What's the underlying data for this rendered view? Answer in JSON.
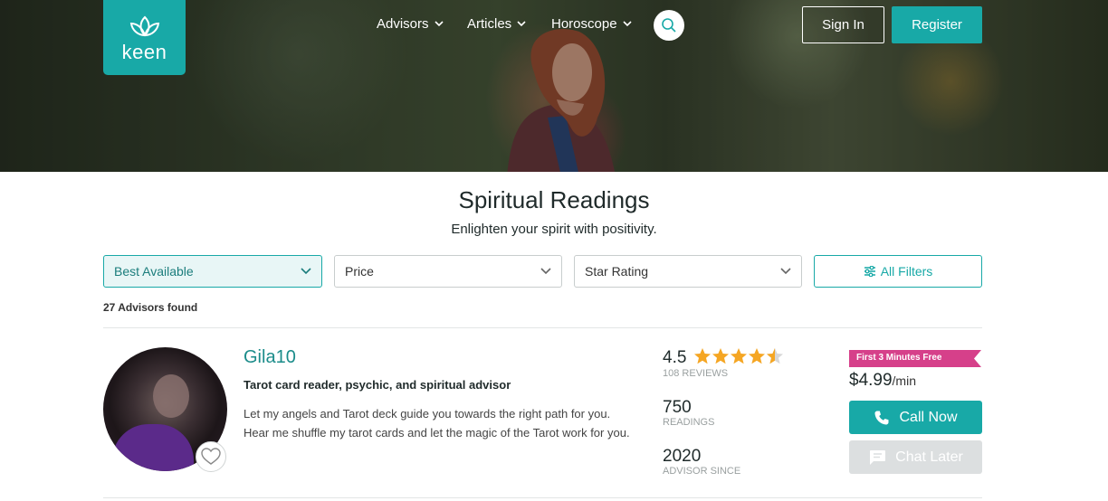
{
  "brand": {
    "logo_text": "keen",
    "accent": "#18a9a7",
    "promo_color": "#d6408a"
  },
  "nav": {
    "items": [
      {
        "label": "Advisors",
        "icon": "chevron-down-icon"
      },
      {
        "label": "Articles",
        "icon": "chevron-down-icon"
      },
      {
        "label": "Horoscope",
        "icon": "chevron-down-icon"
      }
    ],
    "search_icon": "search-icon",
    "sign_in": "Sign In",
    "register": "Register"
  },
  "page": {
    "title": "Spiritual Readings",
    "subtitle": "Enlighten your spirit with positivity."
  },
  "filters": {
    "sort": "Best Available",
    "price": "Price",
    "star_rating": "Star Rating",
    "all_filters": "All Filters",
    "all_filters_icon": "sliders-icon"
  },
  "results": {
    "count_text": "27 Advisors found"
  },
  "advisor": {
    "name": "Gila10",
    "tagline": "Tarot card reader, psychic, and spiritual advisor",
    "description": "Let my angels and Tarot deck guide you towards the right path for you. Hear me shuffle my tarot cards and let the magic of the Tarot work for you.",
    "rating": "4.5",
    "rating_value": 4.5,
    "rating_max": 5,
    "reviews": "108 REVIEWS",
    "readings": "750",
    "readings_label": "READINGS",
    "advisor_since": "2020",
    "advisor_since_label": "ADVISOR SINCE",
    "promo": "First 3 Minutes Free",
    "price": "$4.99",
    "price_unit": "/min",
    "call_label": "Call Now",
    "chat_label": "Chat Later",
    "favorite_icon": "heart-icon"
  }
}
